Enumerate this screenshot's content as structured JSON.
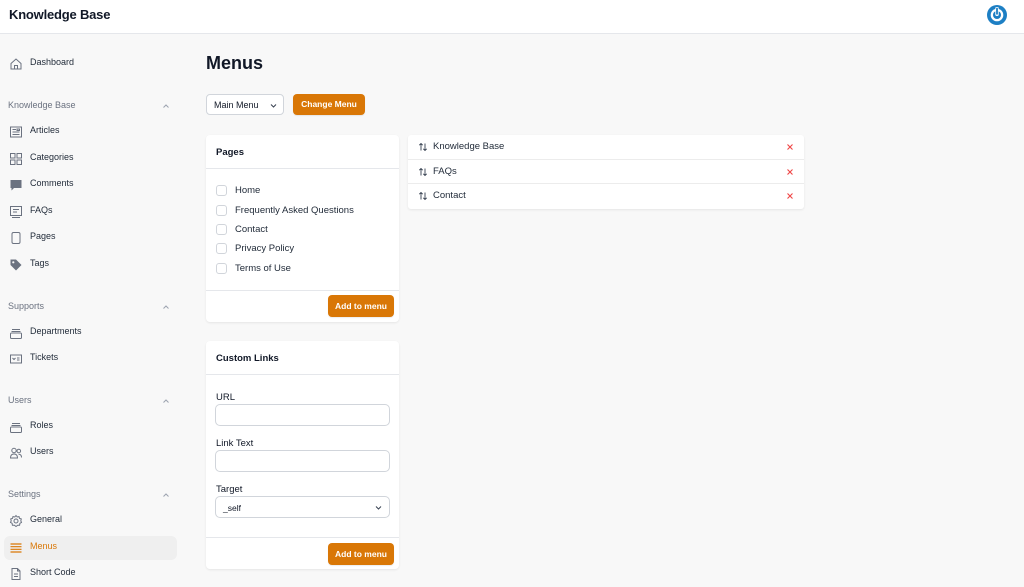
{
  "app": {
    "title": "Knowledge Base"
  },
  "sidebar": {
    "dashboard": "Dashboard",
    "sections": [
      {
        "title": "Knowledge Base",
        "items": [
          "Articles",
          "Categories",
          "Comments",
          "FAQs",
          "Pages",
          "Tags"
        ]
      },
      {
        "title": "Supports",
        "items": [
          "Departments",
          "Tickets"
        ]
      },
      {
        "title": "Users",
        "items": [
          "Roles",
          "Users"
        ]
      },
      {
        "title": "Settings",
        "items": [
          "General",
          "Menus",
          "Short Code"
        ]
      }
    ],
    "active_item": "Menus"
  },
  "main": {
    "title": "Menus",
    "menu_select": {
      "value": "Main Menu"
    },
    "change_button": "Change Menu",
    "pages_card": {
      "title": "Pages",
      "pages": [
        "Home",
        "Frequently Asked Questions",
        "Contact",
        "Privacy Policy",
        "Terms of Use"
      ],
      "add_button": "Add to menu"
    },
    "custom_links_card": {
      "title": "Custom Links",
      "url_label": "URL",
      "url_value": "",
      "link_text_label": "Link Text",
      "link_text_value": "",
      "target_label": "Target",
      "target_value": "_self",
      "add_button": "Add to menu"
    },
    "menu_items": [
      "Knowledge Base",
      "FAQs",
      "Contact"
    ]
  },
  "colors": {
    "accent": "#d97706",
    "remove": "#ef4444",
    "logo": "#1d7fc4"
  }
}
